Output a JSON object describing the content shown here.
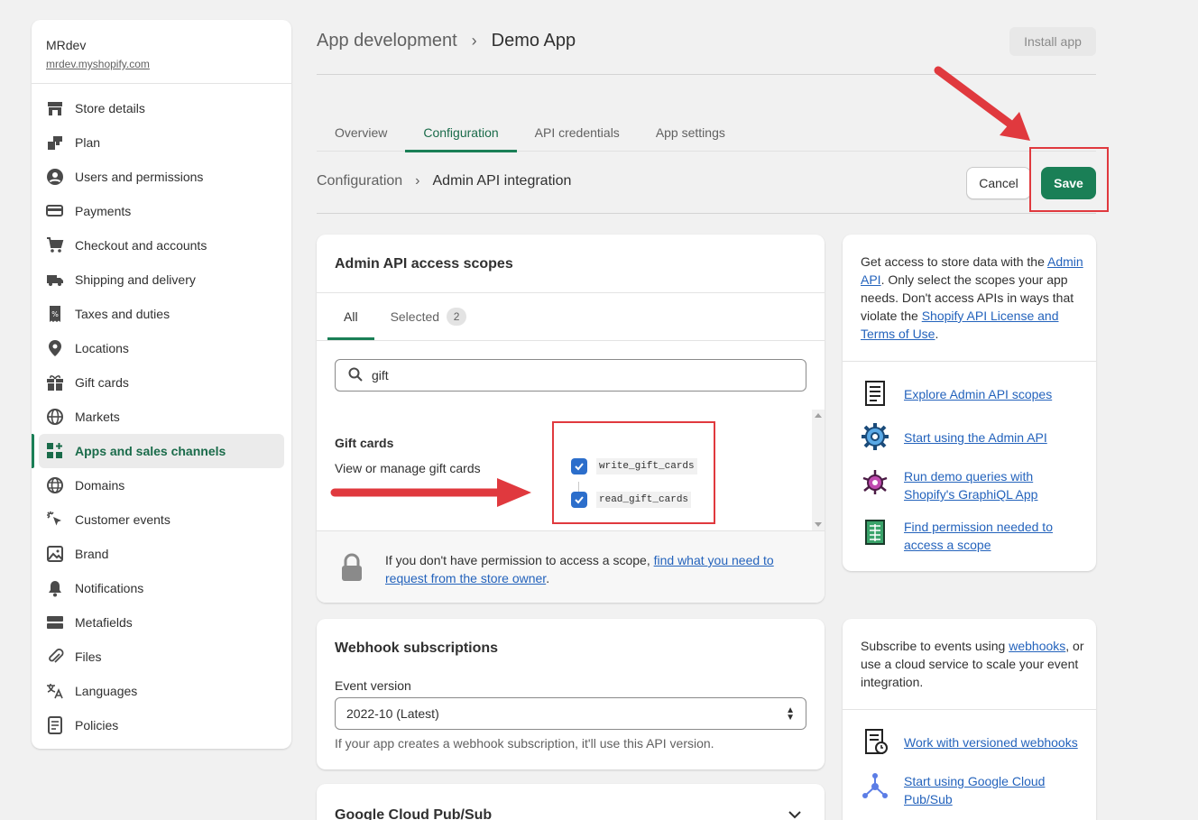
{
  "store": {
    "name": "MRdev",
    "url": "mrdev.myshopify.com"
  },
  "sidebar": {
    "items": [
      {
        "label": "Store details",
        "icon": "store-icon"
      },
      {
        "label": "Plan",
        "icon": "plan-icon"
      },
      {
        "label": "Users and permissions",
        "icon": "user-icon"
      },
      {
        "label": "Payments",
        "icon": "payments-icon"
      },
      {
        "label": "Checkout and accounts",
        "icon": "cart-icon"
      },
      {
        "label": "Shipping and delivery",
        "icon": "truck-icon"
      },
      {
        "label": "Taxes and duties",
        "icon": "tax-icon"
      },
      {
        "label": "Locations",
        "icon": "location-icon"
      },
      {
        "label": "Gift cards",
        "icon": "gift-icon"
      },
      {
        "label": "Markets",
        "icon": "globe-icon"
      },
      {
        "label": "Apps and sales channels",
        "icon": "apps-icon",
        "active": true
      },
      {
        "label": "Domains",
        "icon": "domain-icon"
      },
      {
        "label": "Customer events",
        "icon": "cursor-icon"
      },
      {
        "label": "Brand",
        "icon": "brand-icon"
      },
      {
        "label": "Notifications",
        "icon": "bell-icon"
      },
      {
        "label": "Metafields",
        "icon": "metafields-icon"
      },
      {
        "label": "Files",
        "icon": "paperclip-icon"
      },
      {
        "label": "Languages",
        "icon": "translate-icon"
      },
      {
        "label": "Policies",
        "icon": "policy-icon"
      }
    ]
  },
  "header": {
    "crumb_parent": "App development",
    "crumb_current": "Demo App",
    "install_label": "Install app"
  },
  "tabs": [
    "Overview",
    "Configuration",
    "API credentials",
    "App settings"
  ],
  "subheader": {
    "crumb_parent": "Configuration",
    "crumb_current": "Admin API integration",
    "cancel_label": "Cancel",
    "save_label": "Save"
  },
  "scopes": {
    "title": "Admin API access scopes",
    "tab_all": "All",
    "tab_selected": "Selected",
    "selected_count": "2",
    "search_value": "gift",
    "group_title": "Gift cards",
    "group_desc": "View or manage gift cards",
    "options": [
      "write_gift_cards",
      "read_gift_cards"
    ],
    "perm_text_pre": "If you don't have permission to access a scope, ",
    "perm_link": "find what you need to request from the store owner",
    "perm_text_post": "."
  },
  "info": {
    "t1": "Get access to store data with the ",
    "link_admin_api": "Admin API",
    "t2": ". Only select the scopes your app needs. Don't access APIs in ways that violate the ",
    "link_license": "Shopify API License and Terms of Use",
    "t3": ".",
    "links": [
      "Explore Admin API scopes",
      "Start using the Admin API",
      "Run demo queries with Shopify's GraphiQL App",
      "Find permission needed to access a scope"
    ]
  },
  "webhook": {
    "title": "Webhook subscriptions",
    "event_label": "Event version",
    "event_value": "2022-10 (Latest)",
    "help": "If your app creates a webhook subscription, it'll use this API version."
  },
  "info2": {
    "t1": "Subscribe to events using ",
    "link_webhooks": "webhooks",
    "t2": ", or use a cloud service to scale your event integration.",
    "links": [
      "Work with versioned webhooks",
      "Start using Google Cloud Pub/Sub"
    ]
  },
  "pubsub": {
    "title": "Google Cloud Pub/Sub"
  },
  "colors": {
    "accent": "#1a7f56",
    "annotation": "#e0393e",
    "link": "#2463bc"
  }
}
